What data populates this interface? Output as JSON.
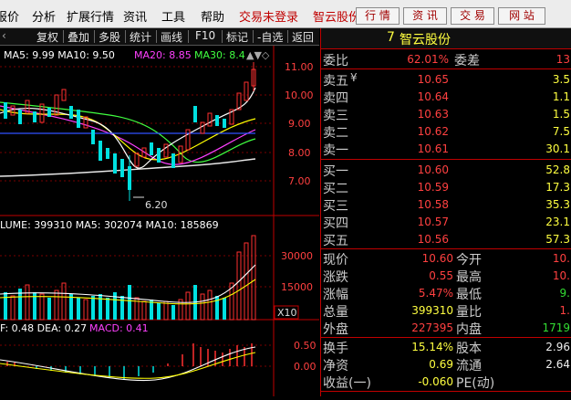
{
  "menu": {
    "items": [
      "报价",
      "分析",
      "扩展行情",
      "资讯",
      "工具",
      "帮助"
    ],
    "login_status": "交易未登录",
    "stock_name": "智云股份",
    "buttons": [
      "行 情",
      "资 讯",
      "交 易",
      "网 站"
    ]
  },
  "toolbar": {
    "items": [
      "复权",
      "叠加",
      "多股",
      "统计",
      "画线",
      "F10",
      "标记",
      "-自选",
      "返回"
    ]
  },
  "chart": {
    "ma_label": "MA5: 9.99 MA10: 9.50",
    "ma20_label": "MA20: 8.85",
    "ma30_label": "MA30: 8.4",
    "price_ticks": [
      "11.00",
      "10.00",
      "9.00",
      "8.00",
      "7.00"
    ],
    "low_label": "6.20",
    "volume_label": "LUME: 399310 MA5: 302074 MA10: 185869",
    "volume_ticks": [
      "30000",
      "15000"
    ],
    "volume_unit": "X10",
    "macd_label": "F: 0.48 DEA: 0.27",
    "macd_value": "MACD: 0.41",
    "macd_ticks": [
      "0.50",
      "0.00"
    ],
    "colors": {
      "ma5": "#ffffff",
      "ma10": "#ffff00",
      "ma20": "#ff40ff",
      "ma30": "#40ff40",
      "up": "#ff3030",
      "down": "#00e0e0"
    }
  },
  "quote": {
    "code_prefix": "7",
    "name": "智云股份",
    "weibi_label": "委比",
    "weibi": "62.01%",
    "weicha_label": "委差",
    "weicha": "13",
    "asks": [
      {
        "label": "卖五",
        "mark": "¥",
        "price": "10.65",
        "vol": "3.5"
      },
      {
        "label": "卖四",
        "mark": "",
        "price": "10.64",
        "vol": "1.1"
      },
      {
        "label": "卖三",
        "mark": "",
        "price": "10.63",
        "vol": "1.5"
      },
      {
        "label": "卖二",
        "mark": "",
        "price": "10.62",
        "vol": "7.5"
      },
      {
        "label": "卖一",
        "mark": "",
        "price": "10.61",
        "vol": "30.1"
      }
    ],
    "bids": [
      {
        "label": "买一",
        "price": "10.60",
        "vol": "52.8"
      },
      {
        "label": "买二",
        "price": "10.59",
        "vol": "17.3"
      },
      {
        "label": "买三",
        "price": "10.58",
        "vol": "35.3"
      },
      {
        "label": "买四",
        "price": "10.57",
        "vol": "23.1"
      },
      {
        "label": "买五",
        "price": "10.56",
        "vol": "57.3"
      }
    ],
    "stats": [
      {
        "l": "现价",
        "v": "10.60",
        "l2": "今开",
        "v2": "10."
      },
      {
        "l": "涨跌",
        "v": "0.55",
        "l2": "最高",
        "v2": "10."
      },
      {
        "l": "涨幅",
        "v": "5.47%",
        "l2": "最低",
        "v2": "9."
      },
      {
        "l": "总量",
        "v": "399310",
        "l2": "量比",
        "v2": "1."
      },
      {
        "l": "外盘",
        "v": "227395",
        "l2": "内盘",
        "v2": "1719"
      }
    ],
    "stats2": [
      {
        "l": "换手",
        "v": "15.14%",
        "l2": "股本",
        "v2": "2.96"
      },
      {
        "l": "净资",
        "v": "0.69",
        "l2": "流通",
        "v2": "2.64"
      },
      {
        "l": "收益(一)",
        "v": "-0.060",
        "l2": "PE(动)",
        "v2": ""
      }
    ]
  }
}
